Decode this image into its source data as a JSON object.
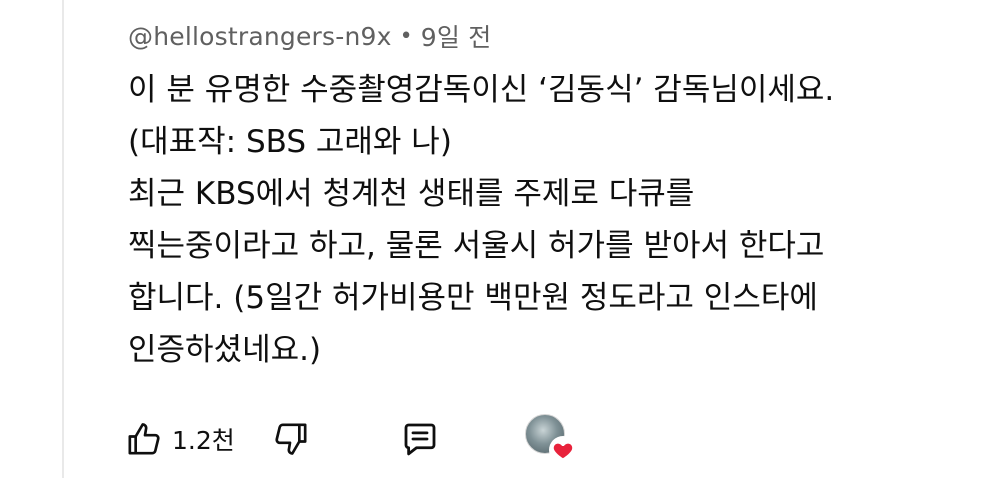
{
  "comment": {
    "author": "@hellostrangers-n9x",
    "separator": "•",
    "time": "9일 전",
    "lines": [
      "이 분 유명한 수중촬영감독이신 ‘김동식’ 감독님이세요.",
      "(대표작: SBS 고래와 나)",
      "최근 KBS에서 청계천 생태를 주제로 다큐를",
      "찍는중이라고 하고, 물론 서울시 허가를 받아서 한다고",
      "합니다. (5일간 허가비용만 백만원 정도라고 인스타에",
      "인증하셨네요.)"
    ]
  },
  "actions": {
    "like_count": "1.2천",
    "icons": [
      "thumbs-up-icon",
      "thumbs-down-icon",
      "reply-comment-icon",
      "creator-heart-icon"
    ],
    "heart_color": "#e8223b"
  }
}
